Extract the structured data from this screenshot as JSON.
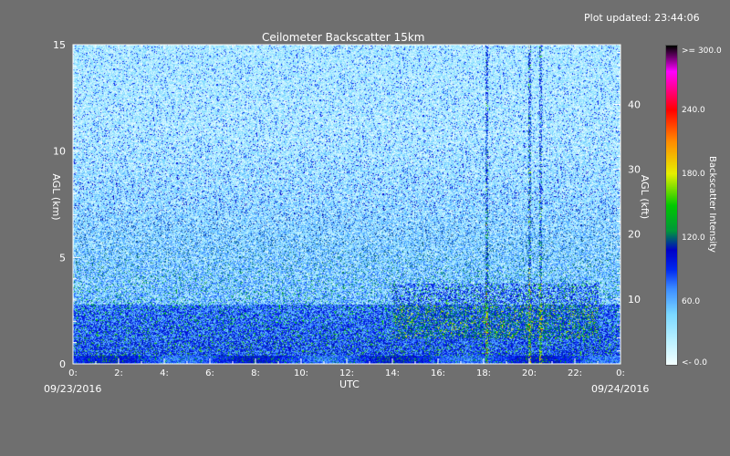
{
  "plot_updated": "Plot updated: 23:44:06",
  "date_start": "09/23/2016",
  "date_end": "09/24/2016",
  "colors": {
    "background": "#6f6f6f",
    "colorscale": [
      "#ffffff",
      "#b8f0ff",
      "#7ad8ff",
      "#3a8cff",
      "#0000ff",
      "#00aa00",
      "#ffff00",
      "#ff8800",
      "#ff0000",
      "#ff00ff",
      "#000000"
    ]
  },
  "chart_data": {
    "type": "heatmap",
    "title": "Ceilometer Backscatter 15km",
    "xlabel": "UTC",
    "ylabel": "AGL (km)",
    "ylabel_right": "AGL (kft)",
    "colorbar_label": "Backscatter Intensity",
    "xlim": [
      0,
      24
    ],
    "ylim_km": [
      0,
      15
    ],
    "ylim_kft": [
      0,
      49.2
    ],
    "x_ticks": [
      "0:",
      "2:",
      "4:",
      "6:",
      "8:",
      "10:",
      "12:",
      "14:",
      "16:",
      "18:",
      "20:",
      "22:",
      "0:"
    ],
    "y_ticks_left": [
      "0",
      "5",
      "10",
      "15"
    ],
    "y_ticks_right": [
      "10",
      "20",
      "30",
      "40"
    ],
    "colorbar_ticks": [
      "<-  0.0",
      "60.0",
      "120.0",
      "180.0",
      "240.0",
      ">= 300.0"
    ],
    "colorbar_range": [
      0,
      300
    ],
    "features": {
      "surface_layer_top_km": 0.4,
      "boundary_layer_top_km": 2.8,
      "aerosol_layer_hours": [
        14,
        23
      ],
      "rain_streak_hours": [
        18.1,
        20.0,
        20.5
      ]
    }
  }
}
